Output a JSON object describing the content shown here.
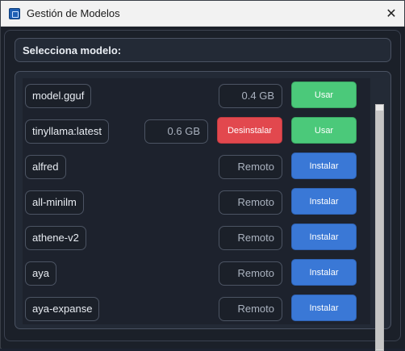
{
  "window": {
    "title": "Gestión de Modelos",
    "close_label": "✕"
  },
  "header": {
    "select_label": "Selecciona modelo:"
  },
  "models": [
    {
      "name": "model.gguf",
      "size": "0.4 GB",
      "uninstall_label": "",
      "action_label": "Usar"
    },
    {
      "name": "tinyllama:latest",
      "size": "0.6 GB",
      "uninstall_label": "Desinstalar",
      "action_label": "Usar"
    },
    {
      "name": "alfred",
      "size": "Remoto",
      "uninstall_label": "",
      "action_label": "Instalar"
    },
    {
      "name": "all-minilm",
      "size": "Remoto",
      "uninstall_label": "",
      "action_label": "Instalar"
    },
    {
      "name": "athene-v2",
      "size": "Remoto",
      "uninstall_label": "",
      "action_label": "Instalar"
    },
    {
      "name": "aya",
      "size": "Remoto",
      "uninstall_label": "",
      "action_label": "Instalar"
    },
    {
      "name": "aya-expanse",
      "size": "Remoto",
      "uninstall_label": "",
      "action_label": "Instalar"
    }
  ],
  "colors": {
    "use_button": "#4bc97a",
    "install_button": "#3a78d6",
    "uninstall_button": "#e2484e"
  },
  "icons": {
    "app": "app-window-icon",
    "close": "close-icon"
  }
}
